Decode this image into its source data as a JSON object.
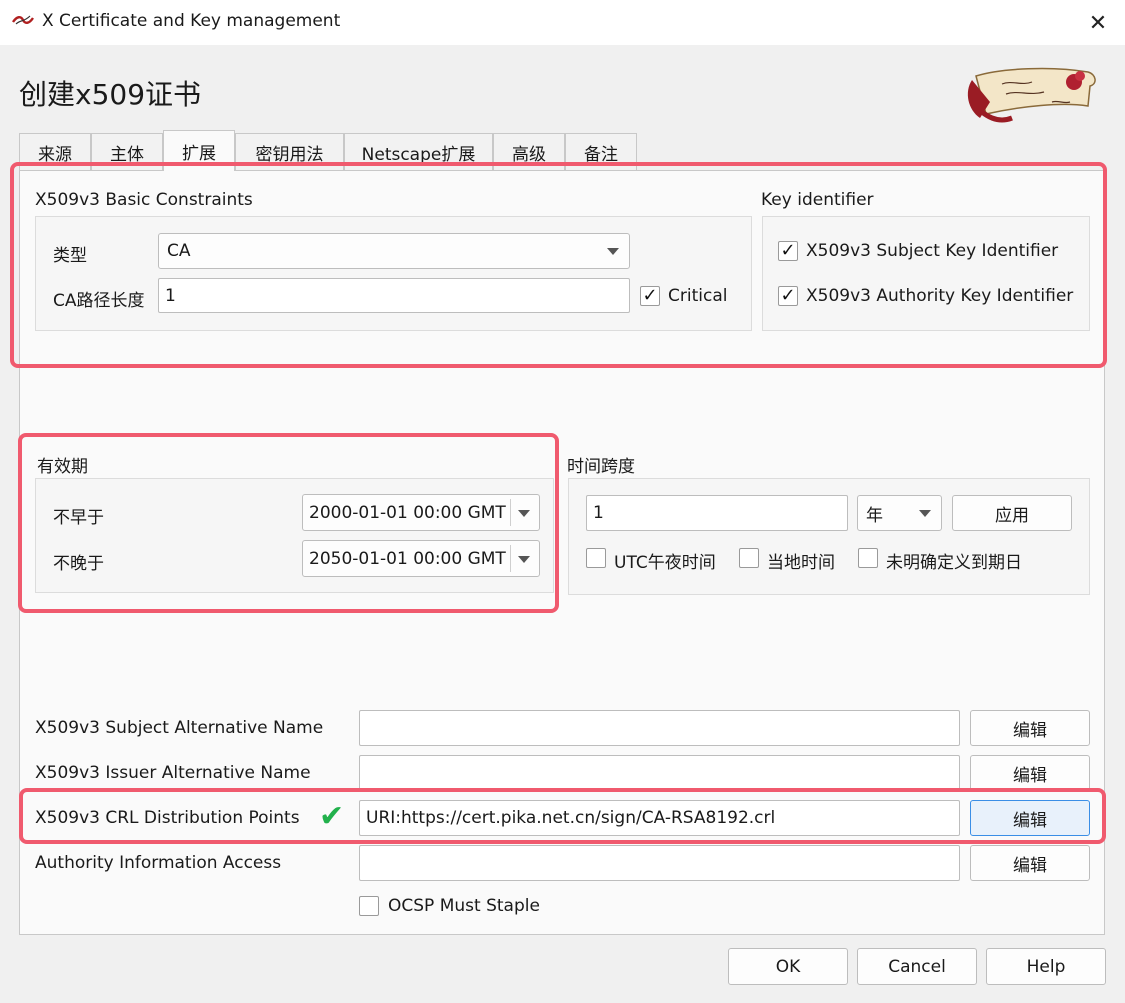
{
  "window": {
    "title": "X Certificate and Key management",
    "close_glyph": "✕"
  },
  "page_title": "创建x509证书",
  "tabs": [
    "来源",
    "主体",
    "扩展",
    "密钥用法",
    "Netscape扩展",
    "高级",
    "备注"
  ],
  "basic_constraints": {
    "title": "X509v3 Basic Constraints",
    "type_label": "类型",
    "type_value": "CA",
    "pathlen_label": "CA路径长度",
    "pathlen_value": "1",
    "critical_label": "Critical",
    "critical_checked": true
  },
  "key_identifier": {
    "title": "Key identifier",
    "subject_label": "X509v3 Subject Key Identifier",
    "subject_checked": true,
    "authority_label": "X509v3 Authority Key Identifier",
    "authority_checked": true
  },
  "validity": {
    "title": "有效期",
    "not_before_label": "不早于",
    "not_before_value": "2000-01-01 00:00 GMT",
    "not_after_label": "不晚于",
    "not_after_value": "2050-01-01 00:00 GMT"
  },
  "time_range": {
    "title": "时间跨度",
    "amount_value": "1",
    "unit_value": "年",
    "apply_label": "应用",
    "utc_midnight_label": "UTC午夜时间",
    "local_time_label": "当地时间",
    "no_expiry_label": "未明确定义到期日"
  },
  "extensions": {
    "san_label": "X509v3 Subject Alternative Name",
    "san_value": "",
    "ian_label": "X509v3 Issuer Alternative Name",
    "ian_value": "",
    "crl_label": "X509v3 CRL Distribution Points",
    "crl_value": "URI:https://cert.pika.net.cn/sign/CA-RSA8192.crl",
    "aia_label": "Authority Information Access",
    "aia_value": "",
    "edit_label": "编辑",
    "ocsp_label": "OCSP Must Staple"
  },
  "buttons": {
    "ok": "OK",
    "cancel": "Cancel",
    "help": "Help"
  },
  "colors": {
    "highlight": "#f05a6e",
    "checkmark": "#22b14c",
    "default_button_border": "#3a8ee6"
  }
}
